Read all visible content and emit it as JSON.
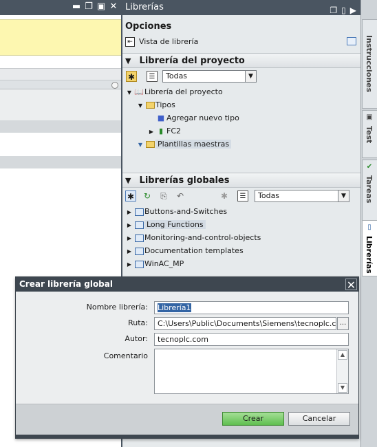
{
  "panel": {
    "title": "Librerías",
    "options_heading": "Opciones",
    "library_view_label": "Vista de librería",
    "project_section": {
      "heading": "Librería del proyecto",
      "filter_value": "Todas",
      "tree": [
        {
          "label": "Librería del proyecto",
          "level": 0,
          "expanded": true,
          "icon": "project-library-icon"
        },
        {
          "label": "Tipos",
          "level": 1,
          "expanded": true,
          "icon": "folder-icon"
        },
        {
          "label": "Agregar nuevo tipo",
          "level": 2,
          "icon": "add-type-icon"
        },
        {
          "label": "FC2",
          "level": 2,
          "expanded": false,
          "icon": "function-block-icon"
        },
        {
          "label": "Plantillas maestras",
          "level": 1,
          "expanded": true,
          "icon": "folder-icon",
          "highlighted": true
        }
      ]
    },
    "global_section": {
      "heading": "Librerías globales",
      "filter_value": "Todas",
      "items": [
        {
          "label": "Buttons-and-Switches"
        },
        {
          "label": "Long Functions",
          "highlighted": true
        },
        {
          "label": "Monitoring-and-control-objects"
        },
        {
          "label": "Documentation templates"
        },
        {
          "label": "WinAC_MP"
        }
      ]
    }
  },
  "side_tabs": [
    {
      "label": "Instrucciones",
      "active": false
    },
    {
      "label": "Test",
      "active": false
    },
    {
      "label": "Tareas",
      "active": false
    },
    {
      "label": "Librerías",
      "active": true
    }
  ],
  "dialog": {
    "title": "Crear librería global",
    "close_glyph": "✕",
    "fields": {
      "name_label": "Nombre librería:",
      "name_value": "Librería1",
      "path_label": "Ruta:",
      "path_value": "C:\\Users\\Public\\Documents\\Siemens\\tecnoplc.co",
      "browse_label": "...",
      "author_label": "Autor:",
      "author_value": "tecnoplc.com",
      "comment_label": "Comentario"
    },
    "create_button": "Crear",
    "cancel_button": "Cancelar",
    "colors": {
      "create_button": "#5fbf4f",
      "title_bar": "#3e4750"
    }
  }
}
